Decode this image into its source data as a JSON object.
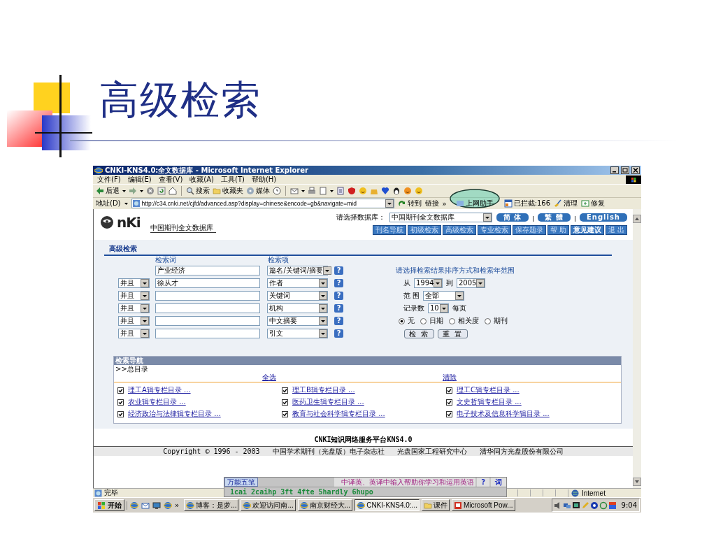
{
  "slide": {
    "title": "高级检索"
  },
  "window": {
    "title": "CNKI-KNS4.0:全文数据库 - Microsoft Internet Explorer"
  },
  "menu": [
    "文件(F)",
    "编辑(E)",
    "查看(V)",
    "收藏(A)",
    "工具(T)",
    "帮助(H)"
  ],
  "toolbar": {
    "back": "后退",
    "search": "搜索",
    "favorites": "收藏夹",
    "media": "媒体"
  },
  "address": {
    "label": "地址(D)",
    "url": "http://c34.cnki.net/cjfd/advanced.asp?display=chinese&encode=gb&navigate=mid",
    "go": "转到",
    "links": "链接",
    "more": "»",
    "helper": "上网助手",
    "blocked": "已拦截:166",
    "clean": "清理",
    "repair": "修复"
  },
  "site": {
    "logo": "nKi",
    "subtitle": "中国期刊全文数据库",
    "db_label": "请选择数据库：",
    "db_select": "中国期刊全文数据库",
    "languages": [
      "简 体",
      "繁 體",
      "English"
    ],
    "nav_tabs": [
      {
        "label": "刊名导航",
        "emphasized": false
      },
      {
        "label": "初级检索",
        "emphasized": false
      },
      {
        "label": "高级检索",
        "emphasized": false
      },
      {
        "label": "专业检索",
        "emphasized": false
      },
      {
        "label": "保存题录",
        "emphasized": false
      },
      {
        "label": "帮 助",
        "emphasized": false
      },
      {
        "label": "意见建议",
        "emphasized": true
      },
      {
        "label": "退 出",
        "emphasized": false
      }
    ]
  },
  "search": {
    "title": "高级检索",
    "col_term": "检索词",
    "col_field": "检索项",
    "rows": [
      {
        "term": "产业经济",
        "field": "篇名/关键词/摘要",
        "help": "?"
      },
      {
        "logic": "并且",
        "term": "徐从才",
        "field": "作者",
        "help": "?"
      },
      {
        "logic": "并且",
        "field": "关键词",
        "help": "?"
      },
      {
        "logic": "并且",
        "field": "机构",
        "help": "?"
      },
      {
        "logic": "并且",
        "field": "中文摘要",
        "help": "?"
      },
      {
        "logic": "并且",
        "field": "引文",
        "help": "?"
      }
    ]
  },
  "options": {
    "title": "请选择检索结果排序方式和检索年范围",
    "from_label": "从",
    "from": "1994",
    "to_label": "到",
    "to": "2005",
    "range_label": "范 围",
    "range": "全部",
    "count_label": "记录数",
    "count": "10",
    "per_page": "每页",
    "sort": [
      {
        "label": "无",
        "selected": true
      },
      {
        "label": "日期",
        "selected": false
      },
      {
        "label": "相关度",
        "selected": false
      },
      {
        "label": "期刊",
        "selected": false
      }
    ],
    "buttons": [
      "检 索",
      "重 置"
    ]
  },
  "nav": {
    "title": "检索导航",
    "root": ">>总目录",
    "select_all": "全选",
    "clear": "清除",
    "items": [
      {
        "label": "理工A辑专栏目录 ...",
        "checked": true
      },
      {
        "label": "理工B辑专栏目录 ...",
        "checked": true
      },
      {
        "label": "理工C辑专栏目录 ...",
        "checked": true
      },
      {
        "label": "农业辑专栏目录 ...",
        "checked": true
      },
      {
        "label": "医药卫生辑专栏目录 ...",
        "checked": true
      },
      {
        "label": "文史哲辑专栏目录 ...",
        "checked": true
      },
      {
        "label": "经济政治与法律辑专栏目录 ...",
        "checked": true
      },
      {
        "label": "教育与社会科学辑专栏目录 ...",
        "checked": true
      },
      {
        "label": "电子技术及信息科学辑目录 ...",
        "checked": true
      }
    ]
  },
  "footer": {
    "platform": "CNKI知识网络服务平台KNS4.0",
    "copyright": "Copyright © 1996 - 2003   中国学术期刊（光盘版）电子杂志社   光盘国家工程研究中心   清华同方光盘股份有限公司"
  },
  "ime": {
    "name": "万能五笔",
    "hint": "中译英、英译中输入帮助你学习和运用英语",
    "help": "?",
    "dict": "词",
    "candidates": "1cai 2caihp 3ft 4fte 5hardly 6hupo"
  },
  "status": {
    "text": "完毕",
    "zone": "Internet"
  },
  "taskbar": {
    "start": "开始",
    "more": "»",
    "tasks": [
      {
        "label": "博客：是萝...",
        "kind": "browser",
        "selected": false
      },
      {
        "label": "欢迎访问南...",
        "kind": "browser",
        "selected": false
      },
      {
        "label": "南京财经大...",
        "kind": "browser",
        "selected": false
      },
      {
        "label": "CNKI-KNS4.0:...",
        "kind": "browser",
        "selected": true
      },
      {
        "label": "课件",
        "kind": "folder",
        "selected": false
      },
      {
        "label": "Microsoft Pow...",
        "kind": "slides",
        "selected": false
      }
    ],
    "clock": "9:04"
  }
}
